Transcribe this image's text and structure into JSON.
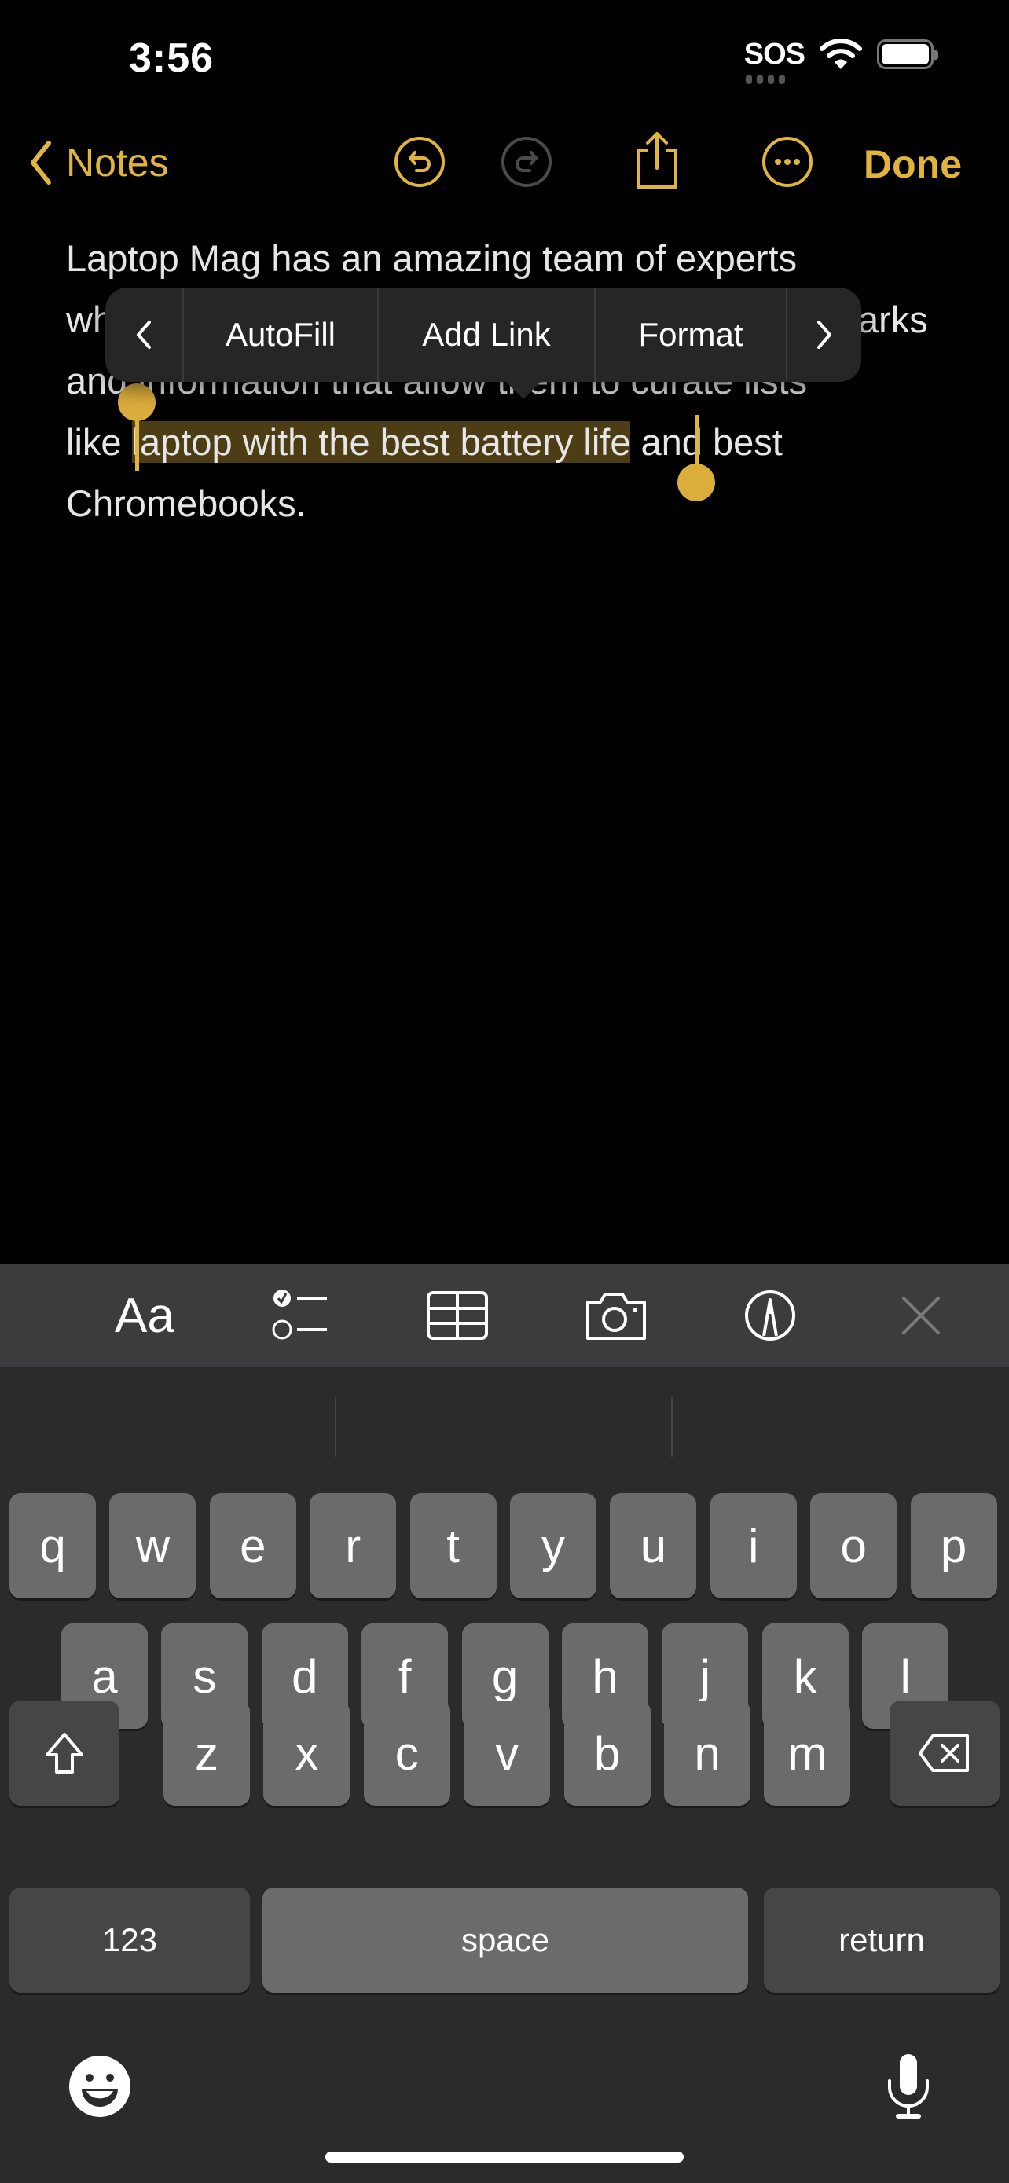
{
  "status_bar": {
    "time": "3:56",
    "carrier": "SOS",
    "wifi_icon": "wifi-icon",
    "battery_icon": "battery-full-icon"
  },
  "nav": {
    "back_label": "Notes",
    "back_icon": "chevron-left-icon",
    "undo_icon": "undo-icon",
    "redo_icon": "redo-icon",
    "share_icon": "share-icon",
    "more_icon": "ellipsis-circle-icon",
    "done_label": "Done"
  },
  "note": {
    "line1": "Laptop Mag has an amazing team of experts",
    "line2_start": "wh",
    "line2_end": "arks",
    "line3": "and information that allow them to curate lists",
    "line4_before": "like ",
    "line4_selected": "laptop with the best battery life",
    "line4_after": " and best",
    "line5": "Chromebooks."
  },
  "edit_menu": {
    "prev_icon": "chevron-left-icon",
    "items": [
      "AutoFill",
      "Add Link",
      "Format"
    ],
    "next_icon": "chevron-right-icon"
  },
  "format_toolbar": {
    "text_style_label": "Aa",
    "items": [
      "checklist-icon",
      "table-icon",
      "camera-icon",
      "markup-icon",
      "close-icon"
    ]
  },
  "keyboard": {
    "row1": [
      "q",
      "w",
      "e",
      "r",
      "t",
      "y",
      "u",
      "i",
      "o",
      "p"
    ],
    "row2": [
      "a",
      "s",
      "d",
      "f",
      "g",
      "h",
      "j",
      "k",
      "l"
    ],
    "row3": [
      "z",
      "x",
      "c",
      "v",
      "b",
      "n",
      "m"
    ],
    "numbers_label": "123",
    "space_label": "space",
    "return_label": "return",
    "shift_icon": "shift-icon",
    "delete_icon": "delete-backward-icon",
    "emoji_icon": "emoji-icon",
    "mic_icon": "microphone-icon"
  },
  "colors": {
    "accent": "#E1B43C",
    "selection": "#4C3D15",
    "keyboard_bg": "#2B2B2B",
    "key_bg": "#6B6B6B",
    "key_dark_bg": "#464646",
    "toolbar_bg": "#3C3C3E"
  }
}
